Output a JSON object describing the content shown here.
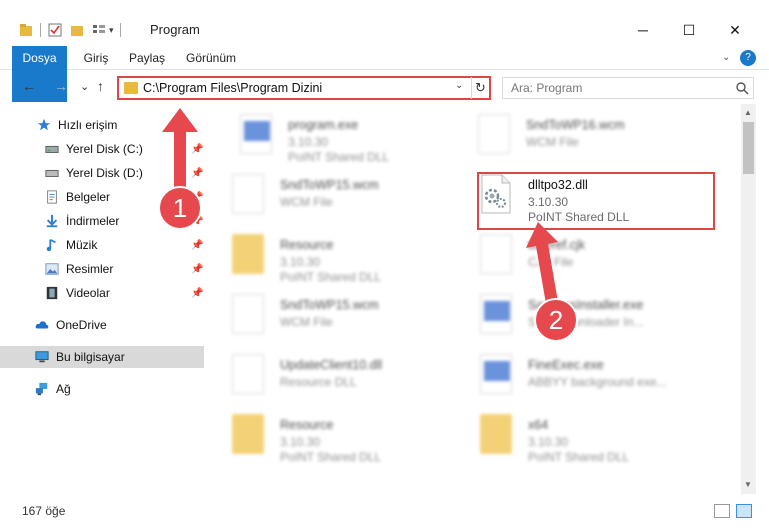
{
  "window": {
    "title": "Program",
    "minimize_glyph": "─",
    "maximize_glyph": "☐",
    "close_glyph": "✕"
  },
  "ribbon": {
    "tabs": [
      "Dosya",
      "Giriş",
      "Paylaş",
      "Görünüm"
    ],
    "help_glyph": "?"
  },
  "nav": {
    "back_glyph": "←",
    "forward_glyph": "→",
    "history_glyph": "⌄",
    "up_glyph": "↑",
    "address": "C:\\Program Files\\Program Dizini",
    "dropdown_glyph": "⌄",
    "refresh_glyph": "↻",
    "search_placeholder": "Ara: Program",
    "search_icon": "magnifier-icon"
  },
  "sidebar": {
    "items": [
      {
        "label": "Hızlı erişim",
        "icon": "star-icon"
      },
      {
        "label": "Yerel Disk (C:)",
        "icon": "drive-icon"
      },
      {
        "label": "Yerel Disk (D:)",
        "icon": "drive-icon"
      },
      {
        "label": "Belgeler",
        "icon": "documents-icon"
      },
      {
        "label": "İndirmeler",
        "icon": "download-icon"
      },
      {
        "label": "Müzik",
        "icon": "music-icon"
      },
      {
        "label": "Resimler",
        "icon": "pictures-icon"
      },
      {
        "label": "Videolar",
        "icon": "video-icon"
      },
      {
        "label": "OneDrive",
        "icon": "cloud-icon"
      },
      {
        "label": "Bu bilgisayar",
        "icon": "computer-icon"
      },
      {
        "label": "Ağ",
        "icon": "network-icon"
      }
    ]
  },
  "files": [
    {
      "name": "program.exe",
      "meta1": "3.10.30",
      "meta2": "PoINT Shared DLL"
    },
    {
      "name": "SndToWP16.wcm",
      "meta1": "WCM File",
      "meta2": ""
    },
    {
      "name": "SndToWP15.wcm",
      "meta1": "WCM File",
      "meta2": ""
    },
    {
      "name": "dlltpo32.dll",
      "meta1": "3.10.30",
      "meta2": "PoINT Shared DLL"
    },
    {
      "name": "Resource",
      "meta1": "3.10.30",
      "meta2": "PoINT Shared DLL"
    },
    {
      "name": "tokeref.cjk",
      "meta1": "CJK File",
      "meta2": ""
    },
    {
      "name": "SndToWP15.wcm",
      "meta1": "WCM File",
      "meta2": ""
    },
    {
      "name": "SamsmsInstaller.exe",
      "meta1": "Sam Downloader In...",
      "meta2": ""
    },
    {
      "name": "UpdateClient10.dll",
      "meta1": "Resource DLL",
      "meta2": ""
    },
    {
      "name": "FineExec.exe",
      "meta1": "ABBYY background exe...",
      "meta2": ""
    },
    {
      "name": "Resource",
      "meta1": "3.10.30",
      "meta2": "PoINT Shared DLL"
    },
    {
      "name": "x64",
      "meta1": "3.10.30",
      "meta2": "PoINT Shared DLL"
    }
  ],
  "annotations": {
    "step1": "1",
    "step2": "2"
  },
  "status": {
    "count": "167 öğe"
  },
  "colors": {
    "accent": "#1979ca",
    "highlight": "#e04545"
  }
}
